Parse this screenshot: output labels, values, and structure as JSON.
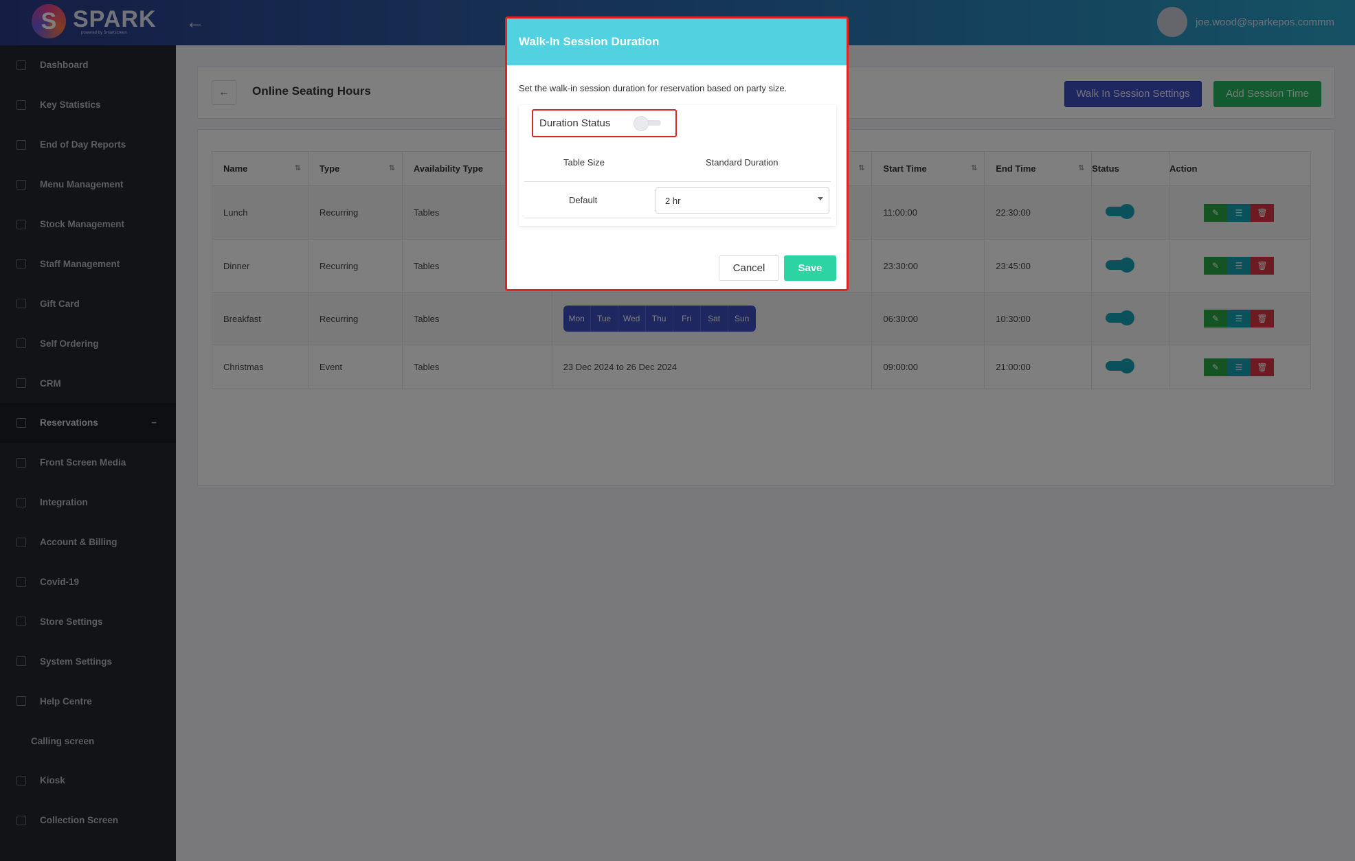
{
  "topbar": {
    "brand": "SPARK",
    "brand_sub": "powered by Smartscreen",
    "user_email": "joe.wood@sparkepos.commm"
  },
  "sidebar": {
    "items": [
      {
        "label": "Dashboard",
        "icon": "dashboard-icon"
      },
      {
        "label": "Key Statistics",
        "icon": "bar-chart-icon"
      },
      {
        "label": "End of Day Reports",
        "icon": "report-icon"
      },
      {
        "label": "Menu Management",
        "icon": "cart-icon"
      },
      {
        "label": "Stock Management",
        "icon": "database-icon"
      },
      {
        "label": "Staff Management",
        "icon": "user-icon"
      },
      {
        "label": "Gift Card",
        "icon": "gift-icon"
      },
      {
        "label": "Self Ordering",
        "icon": "tablet-icon"
      },
      {
        "label": "CRM",
        "icon": "crown-icon"
      },
      {
        "label": "Reservations",
        "icon": "calendar-icon",
        "collapse": "−"
      },
      {
        "label": "Front Screen Media",
        "icon": "laptop-icon"
      },
      {
        "label": "Integration",
        "icon": "card-icon"
      },
      {
        "label": "Account & Billing",
        "icon": "wallet-icon"
      },
      {
        "label": "Covid-19",
        "icon": "shield-icon"
      },
      {
        "label": "Store Settings",
        "icon": "home-icon"
      },
      {
        "label": "System Settings",
        "icon": "gear-icon"
      },
      {
        "label": "Help Centre",
        "icon": "globe-icon"
      },
      {
        "label": "Calling screen"
      },
      {
        "label": "Kiosk",
        "icon": "monitor-icon"
      },
      {
        "label": "Collection Screen",
        "icon": "expand-icon"
      }
    ]
  },
  "page": {
    "title": "Online Seating Hours",
    "walkin_button": "Walk In Session Settings",
    "add_button": "Add Session Time"
  },
  "table": {
    "headers": [
      "Name",
      "Type",
      "Availability Type",
      "Start Time",
      "End Time",
      "Status",
      "Action"
    ],
    "rows": [
      {
        "name": "Lunch",
        "type": "Recurring",
        "availability": "Tables",
        "start": "11:00:00",
        "end": "22:30:00"
      },
      {
        "name": "Dinner",
        "type": "Recurring",
        "availability": "Tables",
        "start": "23:30:00",
        "end": "23:45:00"
      },
      {
        "name": "Breakfast",
        "type": "Recurring",
        "availability": "Tables",
        "start": "06:30:00",
        "end": "10:30:00",
        "days": [
          "Mon",
          "Tue",
          "Wed",
          "Thu",
          "Fri",
          "Sat",
          "Sun"
        ]
      },
      {
        "name": "Christmas",
        "type": "Event",
        "availability": "Tables",
        "period": "23 Dec 2024 to 26 Dec 2024",
        "start": "09:00:00",
        "end": "21:00:00"
      }
    ]
  },
  "modal": {
    "title": "Walk-In Session Duration",
    "description": "Set the walk-in session duration for reservation based on party size.",
    "duration_status_label": "Duration Status",
    "duration_status_on": false,
    "col_table_size": "Table Size",
    "col_standard_duration": "Standard Duration",
    "row_label": "Default",
    "row_value": "2 hr",
    "cancel": "Cancel",
    "save": "Save"
  },
  "colors": {
    "modal_header": "#52d1e1",
    "highlight": "#e02424",
    "save": "#2ed3a4",
    "walkin": "#3f4ec2",
    "add": "#27b561"
  }
}
